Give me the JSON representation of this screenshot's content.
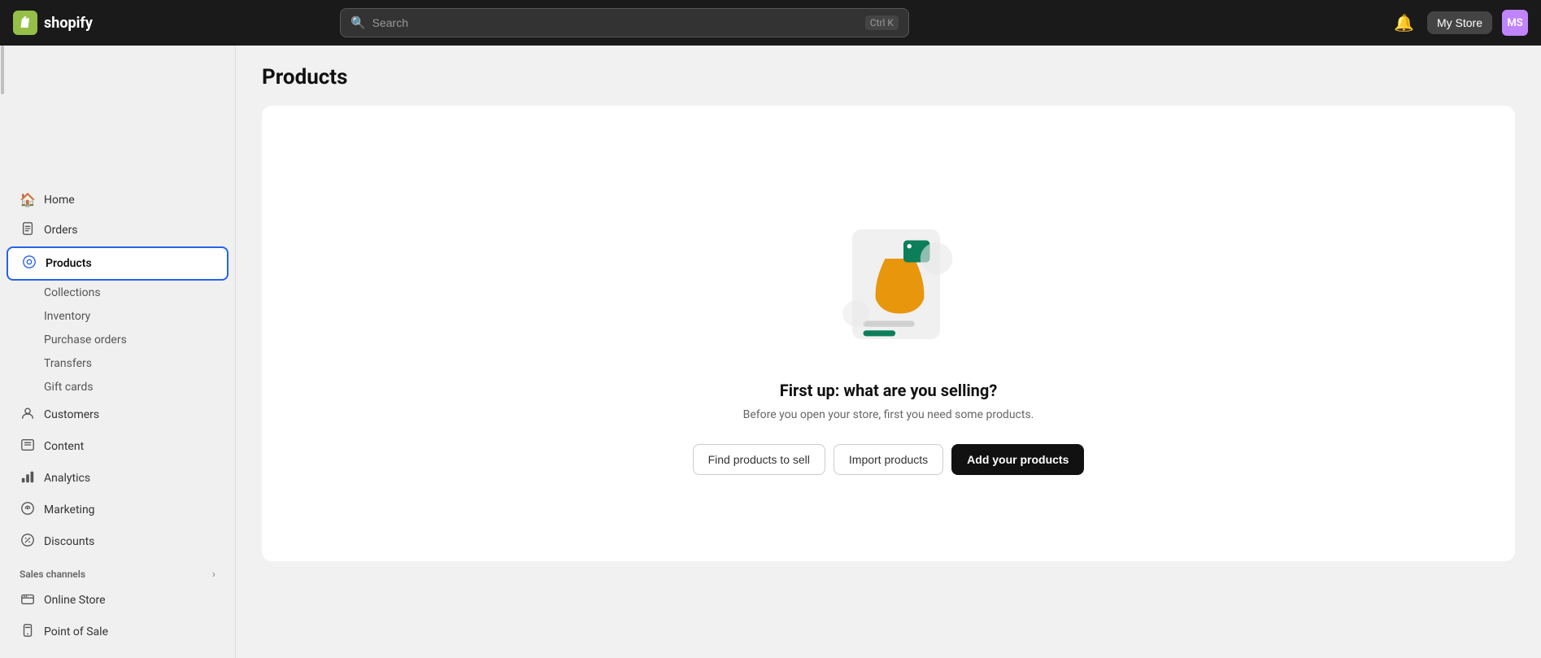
{
  "topnav": {
    "logo_text": "shopify",
    "search_placeholder": "Search",
    "search_shortcut": "Ctrl K",
    "store_name": "My Store",
    "avatar_initials": "MS"
  },
  "sidebar": {
    "nav_items": [
      {
        "id": "home",
        "label": "Home",
        "icon": "🏠",
        "active": false
      },
      {
        "id": "orders",
        "label": "Orders",
        "icon": "📦",
        "active": false
      },
      {
        "id": "products",
        "label": "Products",
        "icon": "🏷",
        "active": true
      }
    ],
    "products_subitems": [
      {
        "id": "collections",
        "label": "Collections"
      },
      {
        "id": "inventory",
        "label": "Inventory"
      },
      {
        "id": "purchase-orders",
        "label": "Purchase orders"
      },
      {
        "id": "transfers",
        "label": "Transfers"
      },
      {
        "id": "gift-cards",
        "label": "Gift cards"
      }
    ],
    "other_nav_items": [
      {
        "id": "customers",
        "label": "Customers",
        "icon": "👤"
      },
      {
        "id": "content",
        "label": "Content",
        "icon": "🖥"
      },
      {
        "id": "analytics",
        "label": "Analytics",
        "icon": "📊"
      },
      {
        "id": "marketing",
        "label": "Marketing",
        "icon": "🎯"
      },
      {
        "id": "discounts",
        "label": "Discounts",
        "icon": "🏷"
      }
    ],
    "sales_channels_label": "Sales channels",
    "sales_channels_items": [
      {
        "id": "online-store",
        "label": "Online Store",
        "icon": "🏪"
      },
      {
        "id": "point-of-sale",
        "label": "Point of Sale",
        "icon": "💳"
      }
    ]
  },
  "main": {
    "page_title": "Products",
    "empty_state": {
      "title": "First up: what are you selling?",
      "subtitle": "Before you open your store, first you need some products.",
      "btn_find": "Find products to sell",
      "btn_import": "Import products",
      "btn_add": "Add your products"
    }
  }
}
